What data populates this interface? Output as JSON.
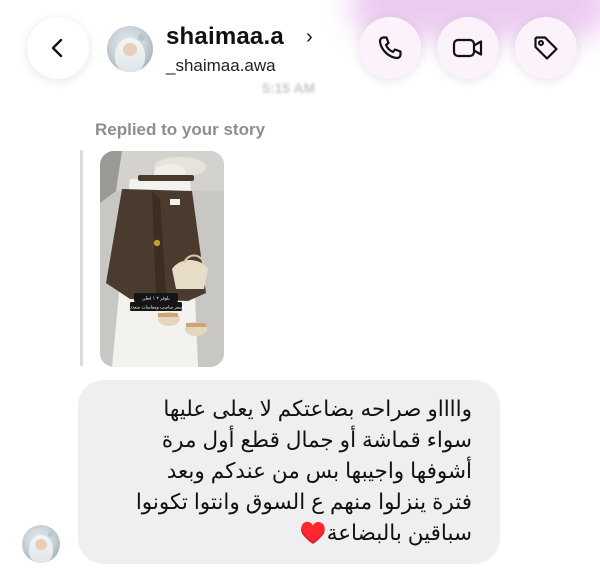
{
  "header": {
    "username": "shaimaa.a",
    "handle": "_shaimaa.awa",
    "chevron": "›",
    "back_icon": "chevron-left-icon",
    "actions": [
      "phone-icon",
      "video-camera-icon",
      "tag-icon"
    ]
  },
  "thread": {
    "timestamp_blurred": "5:15 AM",
    "reply_label": "Replied to your story",
    "story_caption_line1": "بلوفر ٢ ١ قطن",
    "story_caption_line2": "بسعر مناسب ومقاسات متعددة",
    "message": {
      "lines": [
        "وااااو صراحه بضاعتكم لا يعلى عليها",
        "سواء قماشة أو جمال قطع أول مرة",
        "أشوفها واجيبها بس من عندكم وبعد",
        "فترة ينزلوا منهم ع السوق وانتوا تكونوا",
        "سباقين بالبضاعة"
      ],
      "emoji": "♥️"
    }
  },
  "colors": {
    "accent_glow": "#e9c6ee",
    "bubble": "#efeff1",
    "heart": "#c0121f",
    "muted_text": "#8e8e8e"
  }
}
